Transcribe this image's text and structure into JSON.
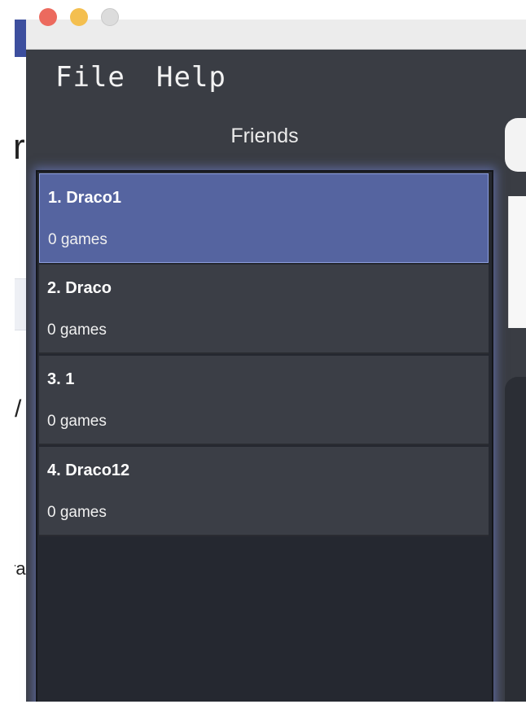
{
  "window": {
    "controls": [
      "close",
      "minimize",
      "zoom"
    ]
  },
  "menu": {
    "items": [
      {
        "label": "File"
      },
      {
        "label": "Help"
      }
    ]
  },
  "friends_panel": {
    "title": "Friends",
    "items": [
      {
        "name": "1. Draco1",
        "games": "0 games",
        "selected": true
      },
      {
        "name": "2. Draco",
        "games": "0 games",
        "selected": false
      },
      {
        "name": "3. 1",
        "games": "0 games",
        "selected": false
      },
      {
        "name": "4. Draco12",
        "games": "0 games",
        "selected": false
      }
    ]
  },
  "background_window": {
    "fragments": [
      "r",
      "/",
      "ra"
    ]
  },
  "colors": {
    "app_background": "#3a3d44",
    "selected_item": "#5564a0",
    "list_item": "#3b3e46",
    "list_background": "#252830",
    "glow": "#788ce6"
  }
}
